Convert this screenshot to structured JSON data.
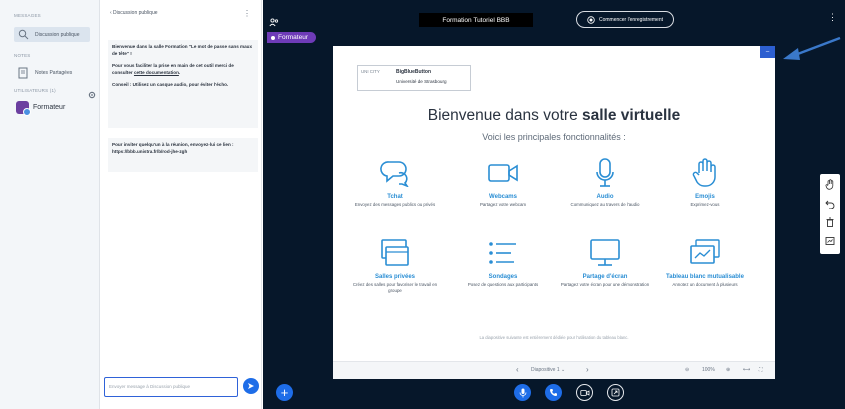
{
  "sidebar": {
    "messages_heading": "MESSAGES",
    "public_chat_label": "Discussion publique",
    "notes_heading": "NOTES",
    "shared_notes_label": "Notes Partagées",
    "users_heading": "UTILISATEURS (1)",
    "user_name": "Formateur"
  },
  "chat": {
    "header": "‹  Discussion publique",
    "welcome_1": "Bienvenue dans la salle Formation \"Le mot de passe sans maux de tête\" !",
    "welcome_2a": "Pour vous faciliter la prise en main de cet outil merci de consulter ",
    "welcome_2_link": "cette documentation",
    "welcome_2b": ".",
    "welcome_3": "Conseil : Utilisez un casque audio, pour éviter l'écho.",
    "invite": "Pour inviter quelqu'un à la réunion, envoyez-lui ce lien : https://bbb.unistra.fr/b/rod-jhe-zgh",
    "input_placeholder": "Envoyer message à Discussion publique"
  },
  "topbar": {
    "title": "Formation Tutoriel BBB",
    "record_label": "Commencer l'enregistrement",
    "presenter_tag": "Formateur"
  },
  "slide": {
    "logo_title": "BigBlueButton",
    "logo_sub": "Université de Strasbourg",
    "logo_tag": "UNI CITY",
    "heading_prefix": "Bienvenue dans votre ",
    "heading_bold": "salle virtuelle",
    "subheading": "Voici les principales fonctionnalités :",
    "features": [
      {
        "icon": "chat-bubbles-icon",
        "title": "Tchat",
        "desc": "Envoyez des messages publics ou privés"
      },
      {
        "icon": "webcam-icon",
        "title": "Webcams",
        "desc": "Partagez votre webcam"
      },
      {
        "icon": "microphone-icon",
        "title": "Audio",
        "desc": "Communiquez au travers de l'audio"
      },
      {
        "icon": "hand-icon",
        "title": "Emojis",
        "desc": "Exprimez-vous"
      },
      {
        "icon": "breakout-rooms-icon",
        "title": "Salles privées",
        "desc": "Créez des salles pour favoriser le travail en groupe"
      },
      {
        "icon": "poll-list-icon",
        "title": "Sondages",
        "desc": "Posez de questions aux participants"
      },
      {
        "icon": "monitor-icon",
        "title": "Partage d'écran",
        "desc": "Partagez votre écran pour une démonstration"
      },
      {
        "icon": "whiteboard-icon",
        "title": "Tableau blanc mutualisable",
        "desc": "Annotez un document à plusieurs"
      }
    ],
    "footer": "La diapositive suivante est entièrement dédiée pour l'utilisation du tableau blanc."
  },
  "slidebar": {
    "prev": "‹",
    "slide_label": "Diapositive 1 ⌄",
    "next": "›",
    "zoom": "100%"
  }
}
